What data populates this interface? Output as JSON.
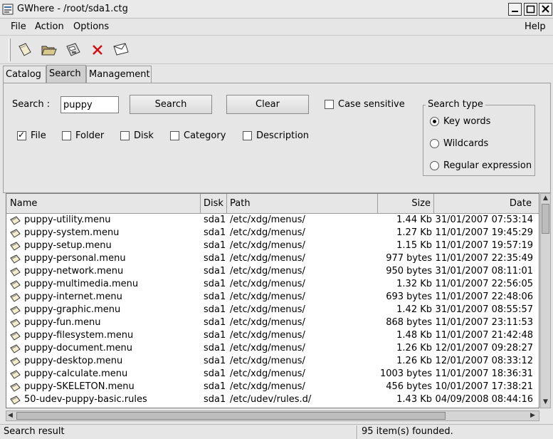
{
  "window": {
    "title": "GWhere - /root/sda1.ctg"
  },
  "menu": {
    "file": "File",
    "action": "Action",
    "options": "Options",
    "help": "Help"
  },
  "toolbar": {
    "icons": [
      "new-catalog-icon",
      "open-folder-icon",
      "save-disk-icon",
      "delete-x-icon",
      "mail-envelope-icon"
    ]
  },
  "tabs": [
    "Catalog",
    "Search",
    "Management"
  ],
  "search": {
    "label": "Search :",
    "value": "puppy",
    "search_button": "Search",
    "clear_button": "Clear",
    "case_sensitive": "Case sensitive",
    "case_sensitive_checked": false,
    "filters": [
      {
        "label": "File",
        "checked": true
      },
      {
        "label": "Folder",
        "checked": false
      },
      {
        "label": "Disk",
        "checked": false
      },
      {
        "label": "Category",
        "checked": false
      },
      {
        "label": "Description",
        "checked": false
      }
    ],
    "search_type": {
      "title": "Search type",
      "options": [
        "Key words",
        "Wildcards",
        "Regular expression"
      ],
      "selected": "Key words"
    }
  },
  "table": {
    "columns": [
      "Name",
      "Disk",
      "Path",
      "Size",
      "Date"
    ],
    "rows": [
      [
        "puppy-utility.menu",
        "sda1",
        "/etc/xdg/menus/",
        "1.44 Kb",
        "31/01/2007 07:53:14"
      ],
      [
        "puppy-system.menu",
        "sda1",
        "/etc/xdg/menus/",
        "1.27 Kb",
        "11/01/2007 19:45:29"
      ],
      [
        "puppy-setup.menu",
        "sda1",
        "/etc/xdg/menus/",
        "1.15 Kb",
        "11/01/2007 19:57:19"
      ],
      [
        "puppy-personal.menu",
        "sda1",
        "/etc/xdg/menus/",
        "977 bytes",
        "11/01/2007 22:35:49"
      ],
      [
        "puppy-network.menu",
        "sda1",
        "/etc/xdg/menus/",
        "950 bytes",
        "31/01/2007 08:11:01"
      ],
      [
        "puppy-multimedia.menu",
        "sda1",
        "/etc/xdg/menus/",
        "1.32 Kb",
        "11/01/2007 22:56:05"
      ],
      [
        "puppy-internet.menu",
        "sda1",
        "/etc/xdg/menus/",
        "693 bytes",
        "11/01/2007 22:48:06"
      ],
      [
        "puppy-graphic.menu",
        "sda1",
        "/etc/xdg/menus/",
        "1.42 Kb",
        "31/01/2007 08:55:57"
      ],
      [
        "puppy-fun.menu",
        "sda1",
        "/etc/xdg/menus/",
        "868 bytes",
        "11/01/2007 23:11:53"
      ],
      [
        "puppy-filesystem.menu",
        "sda1",
        "/etc/xdg/menus/",
        "1.48 Kb",
        "11/01/2007 21:42:48"
      ],
      [
        "puppy-document.menu",
        "sda1",
        "/etc/xdg/menus/",
        "1.26 Kb",
        "12/01/2007 09:28:27"
      ],
      [
        "puppy-desktop.menu",
        "sda1",
        "/etc/xdg/menus/",
        "1.26 Kb",
        "12/01/2007 08:33:12"
      ],
      [
        "puppy-calculate.menu",
        "sda1",
        "/etc/xdg/menus/",
        "1003 bytes",
        "11/01/2007 18:36:31"
      ],
      [
        "puppy-SKELETON.menu",
        "sda1",
        "/etc/xdg/menus/",
        "456 bytes",
        "10/01/2007 17:38:21"
      ],
      [
        "50-udev-puppy-basic.rules",
        "sda1",
        "/etc/udev/rules.d/",
        "1.43 Kb",
        "04/09/2008 08:44:16"
      ]
    ]
  },
  "status": {
    "left": "Search result",
    "right": "95 item(s) founded."
  }
}
